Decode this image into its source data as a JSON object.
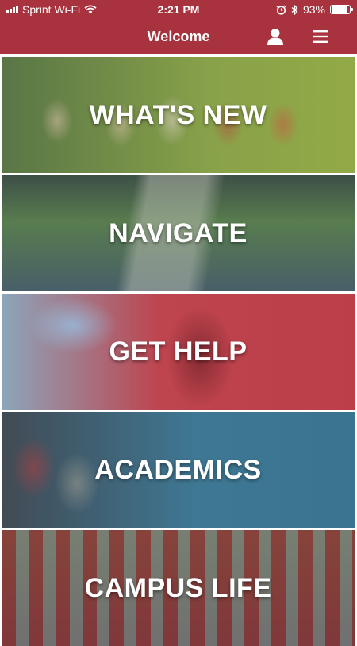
{
  "status_bar": {
    "carrier": "Sprint Wi-Fi",
    "time": "2:21 PM",
    "battery_percent": "93%",
    "battery_level": 0.93,
    "icons": [
      "signal-bars-icon",
      "wifi-icon",
      "alarm-icon",
      "bluetooth-icon",
      "battery-icon"
    ]
  },
  "nav": {
    "title": "Welcome",
    "icons": [
      "user-profile-icon",
      "hamburger-menu-icon"
    ],
    "color": "#a8323d"
  },
  "tiles": [
    {
      "label": "WHAT'S NEW",
      "tint": "#7f9a3a"
    },
    {
      "label": "NAVIGATE",
      "tint": "#3e5660"
    },
    {
      "label": "GET HELP",
      "tint": "#b8343f"
    },
    {
      "label": "ACADEMICS",
      "tint": "#2e6c8a"
    },
    {
      "label": "CAMPUS LIFE",
      "tint": "#3b3b3b"
    }
  ]
}
